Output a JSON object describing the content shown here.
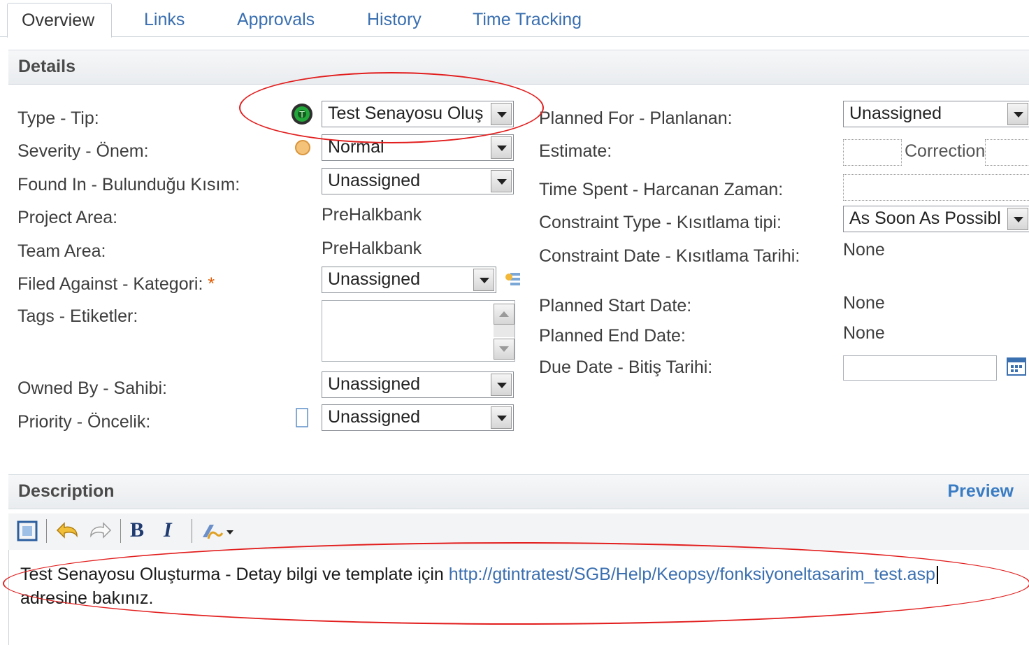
{
  "tabs": [
    {
      "label": "Overview",
      "active": true
    },
    {
      "label": "Links"
    },
    {
      "label": "Approvals"
    },
    {
      "label": "History"
    },
    {
      "label": "Time Tracking"
    }
  ],
  "details": {
    "header": "Details",
    "left": {
      "type": {
        "label": "Type - Tip:",
        "value": "Test Senayosu Oluş",
        "icon": "test-scenario-type-icon"
      },
      "severity": {
        "label": "Severity - Önem:",
        "value": "Normal",
        "icon": "severity-normal-icon"
      },
      "found_in": {
        "label": "Found In - Bulunduğu Kısım:",
        "value": "Unassigned"
      },
      "project_area": {
        "label": "Project Area:",
        "value": "PreHalkbank"
      },
      "team_area": {
        "label": "Team Area:",
        "value": "PreHalkbank"
      },
      "filed_against": {
        "label": "Filed Against - Kategori:",
        "required": "*",
        "value": "Unassigned",
        "icon": "category-browse-icon"
      },
      "tags": {
        "label": "Tags - Etiketler:",
        "value": ""
      },
      "owned_by": {
        "label": "Owned By - Sahibi:",
        "value": "Unassigned"
      },
      "priority": {
        "label": "Priority - Öncelik:",
        "value": "Unassigned",
        "icon": "priority-unassigned-icon"
      }
    },
    "right": {
      "planned_for": {
        "label": "Planned For - Planlanan:",
        "value": "Unassigned"
      },
      "estimate": {
        "label": "Estimate:",
        "correction": "Correction"
      },
      "time_spent": {
        "label": "Time Spent - Harcanan Zaman:",
        "value": ""
      },
      "constraint_type": {
        "label": "Constraint Type - Kısıtlama tipi:",
        "value": "As Soon As Possibl"
      },
      "constraint_date": {
        "label": "Constraint Date - Kısıtlama Tarihi:",
        "value": "None"
      },
      "planned_start": {
        "label": "Planned Start Date:",
        "value": "None"
      },
      "planned_end": {
        "label": "Planned End Date:",
        "value": "None"
      },
      "due_date": {
        "label": "Due Date - Bitiş Tarihi:",
        "value": "",
        "icon": "calendar-icon"
      }
    }
  },
  "description": {
    "header": "Description",
    "preview_label": "Preview",
    "toolbar": [
      "maximize-icon",
      "undo-icon",
      "redo-icon",
      "bold-icon",
      "italic-icon",
      "link-icon"
    ],
    "bold_glyph": "B",
    "italic_glyph": "I",
    "text_before": "Test Senayosu Oluşturma - Detay bilgi ve template için ",
    "link": "http://gtintratest/SGB/Help/Keopsy/fonksiyoneltasarim_test.asp",
    "text_after": "adresine bakınız."
  },
  "colors": {
    "link": "#3a6fb0",
    "annotation": "#e21e1e",
    "required": "#e05a00"
  }
}
